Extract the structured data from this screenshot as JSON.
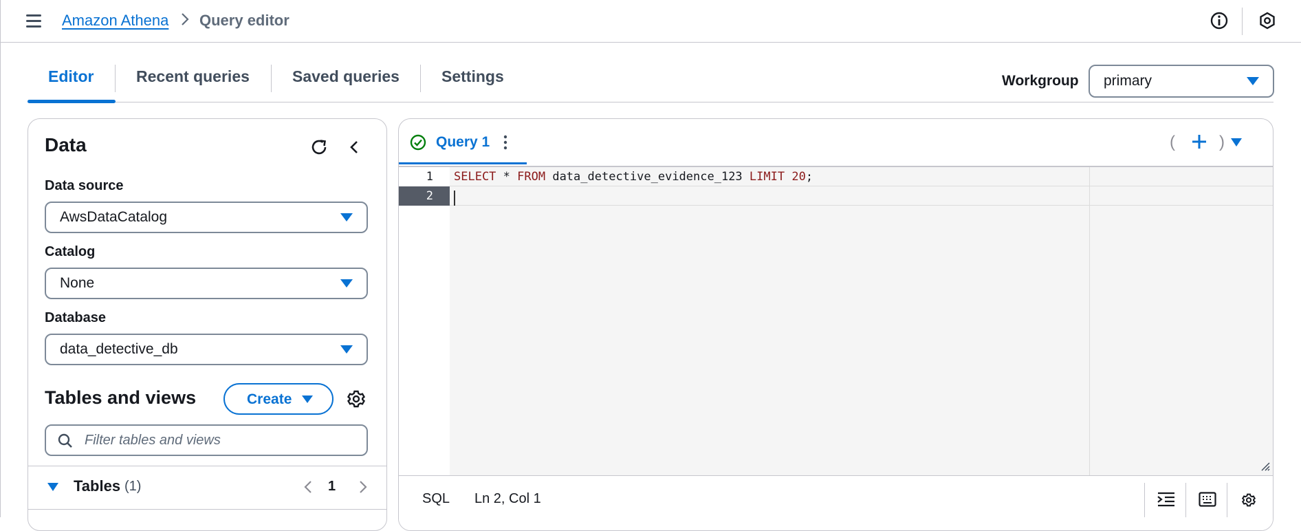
{
  "header": {
    "breadcrumb_service": "Amazon Athena",
    "breadcrumb_current": "Query editor"
  },
  "tabs": [
    {
      "label": "Editor",
      "active": true
    },
    {
      "label": "Recent queries"
    },
    {
      "label": "Saved queries"
    },
    {
      "label": "Settings"
    }
  ],
  "workgroup": {
    "label": "Workgroup",
    "value": "primary"
  },
  "data_panel": {
    "title": "Data",
    "data_source": {
      "label": "Data source",
      "value": "AwsDataCatalog"
    },
    "catalog": {
      "label": "Catalog",
      "value": "None"
    },
    "database": {
      "label": "Database",
      "value": "data_detective_db"
    },
    "tables_and_views": {
      "title": "Tables and views",
      "create_label": "Create",
      "filter_placeholder": "Filter tables and views"
    },
    "tables": {
      "label": "Tables",
      "count": "(1)",
      "page": "1"
    }
  },
  "editor": {
    "query_tab": "Query 1",
    "paren_open": "(",
    "paren_close": ")",
    "lines": [
      {
        "number": "1",
        "kw1": "SELECT",
        "t1": " * ",
        "kw2": "FROM",
        "t2": " data_detective_evidence_123 ",
        "kw3": "LIMIT",
        "t3": " ",
        "num": "20",
        "t4": ";"
      },
      {
        "number": "2"
      }
    ],
    "status": {
      "language": "SQL",
      "position": "Ln 2, Col 1"
    }
  },
  "colors": {
    "accent": "#0972d3",
    "success": "#037f0c",
    "text": "#16191f",
    "border": "#7d8998"
  }
}
